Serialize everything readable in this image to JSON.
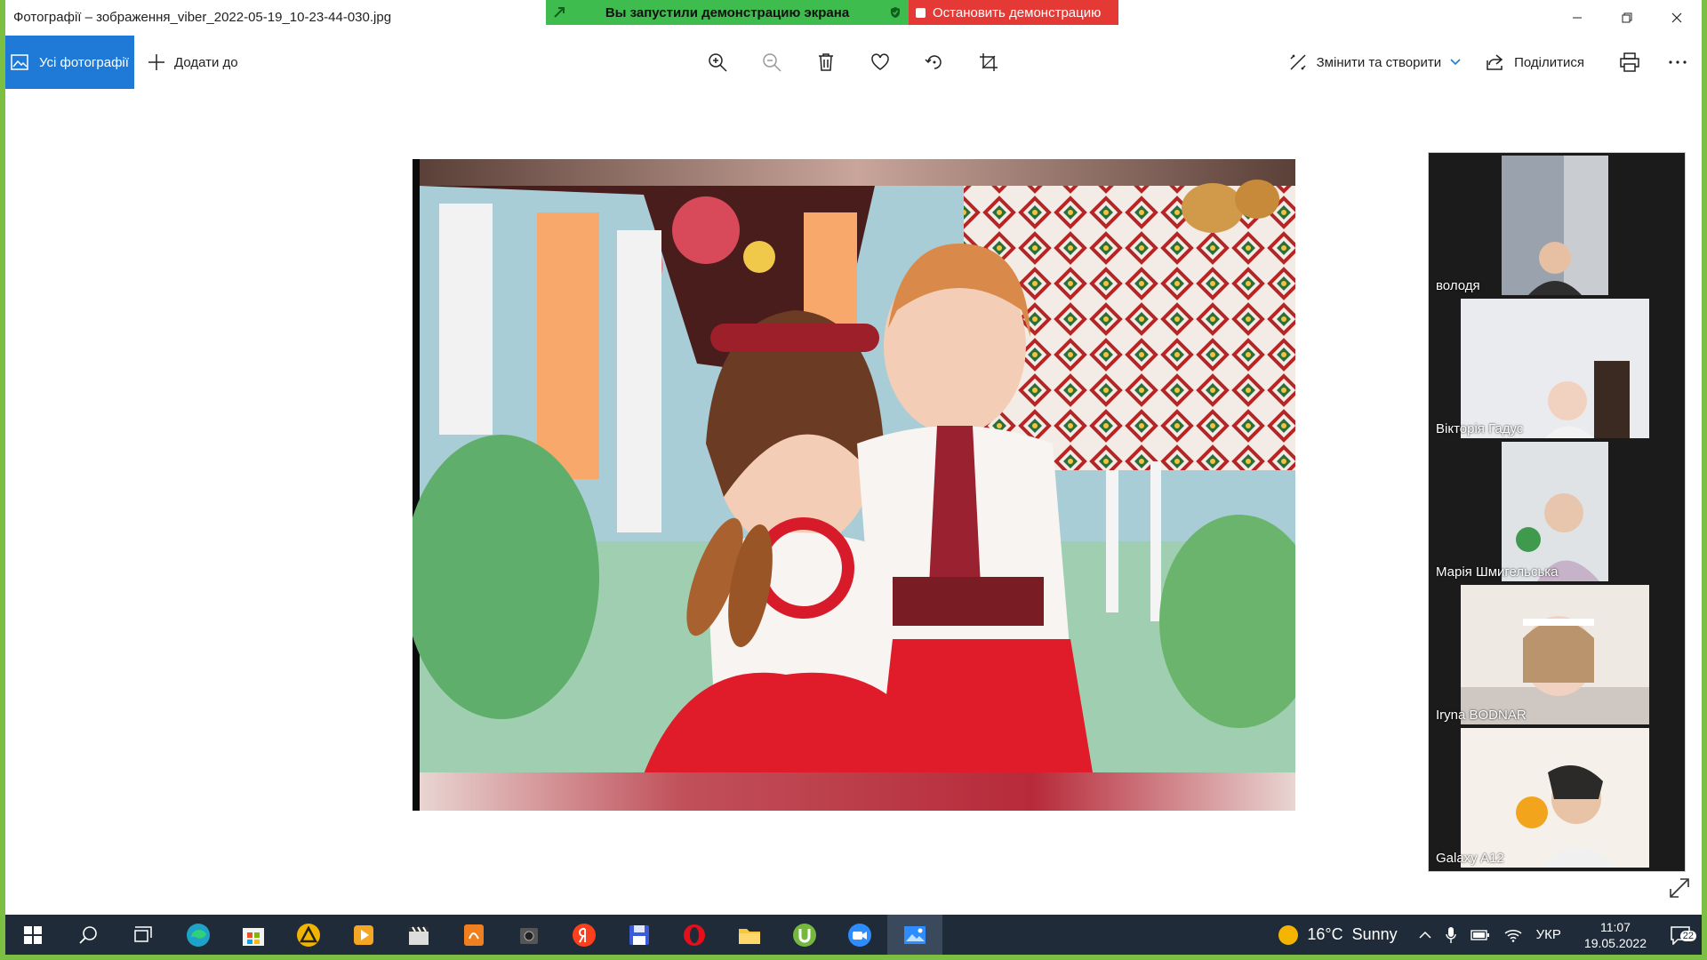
{
  "window": {
    "title": "Фотографії – зображення_viber_2022-05-19_10-23-44-030.jpg"
  },
  "share_banner": {
    "status": "Вы запустили демонстрацию экрана",
    "stop_label": "Остановить демонстрацию"
  },
  "toolbar": {
    "all_photos_label": "Усі фотографії",
    "add_to_label": "Додати до",
    "edit_create_label": "Змінити та створити",
    "share_label": "Поділитися"
  },
  "participants": [
    {
      "name": "володя"
    },
    {
      "name": "Вікторія Гадус"
    },
    {
      "name": "Марія Шмигельська"
    },
    {
      "name": "Iryna BODNAR"
    },
    {
      "name": "Galaxy A12"
    }
  ],
  "taskbar": {
    "weather_temp": "16°C",
    "weather_text": "Sunny",
    "language": "УКР",
    "time": "11:07",
    "date": "19.05.2022",
    "notifications": "22"
  },
  "colors": {
    "frame": "#7bc043",
    "accent": "#1e7ad6",
    "banner_green": "#3fbc4e",
    "banner_red": "#e53935",
    "taskbar": "#1f2b38"
  }
}
